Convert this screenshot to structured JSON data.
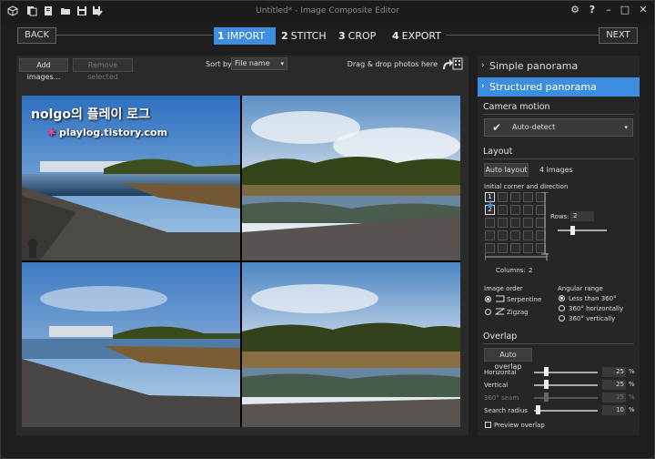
{
  "titlebar": {
    "title": "Untitled* - Image Composite Editor",
    "icons": [
      "cube-icon",
      "new-icon",
      "open-folder-icon",
      "save-icon",
      "save-as-icon"
    ],
    "controls": {
      "settings": "⚙",
      "help": "?",
      "minimize": "–",
      "maximize": "□",
      "close": "✕"
    }
  },
  "stepbar": {
    "back_label": "BACK",
    "next_label": "NEXT",
    "steps": [
      {
        "num": "1",
        "label": "IMPORT"
      },
      {
        "num": "2",
        "label": "STITCH"
      },
      {
        "num": "3",
        "label": "CROP"
      },
      {
        "num": "4",
        "label": "EXPORT"
      }
    ],
    "active_step": 0
  },
  "toolbar": {
    "add_images": "Add images...",
    "remove_selected": "Remove selected",
    "sort_by_label": "Sort by",
    "sort_by_value": "File name",
    "drag_drop": "Drag & drop photos here"
  },
  "watermark": {
    "line1": "nolgo의 플레이 로그",
    "line2": "playlog.tistory.com"
  },
  "panel": {
    "simple_panorama": "Simple panorama",
    "structured_panorama": "Structured panorama",
    "camera_motion_title": "Camera motion",
    "camera_motion_value": "Auto-detect",
    "layout_title": "Layout",
    "auto_layout": "Auto layout",
    "image_count": "4 images",
    "initial_corner": "Initial corner and direction",
    "grid_numbers": [
      "1",
      "2"
    ],
    "rows_label": "Rows:",
    "rows_value": "2",
    "columns_label": "Columns:",
    "columns_value": "2",
    "image_order_title": "Image order",
    "serpentine": "Serpentine",
    "zigzag": "Zigzag",
    "angular_range_title": "Angular range",
    "less_than_360": "Less than 360°",
    "horiz_360": "360° horizontally",
    "vert_360": "360° vertically",
    "overlap_title": "Overlap",
    "auto_overlap": "Auto overlap",
    "horizontal_label": "Horizontal",
    "horizontal_value": "25",
    "vertical_label": "Vertical",
    "vertical_value": "25",
    "seam_label": "360° seam",
    "seam_value": "25",
    "search_radius_label": "Search radius",
    "search_radius_value": "10",
    "percent": "%",
    "preview_overlap": "Preview overlap"
  },
  "colors": {
    "accent": "#3d8ee0",
    "background": "#1e1e1e",
    "panel": "#262626"
  }
}
